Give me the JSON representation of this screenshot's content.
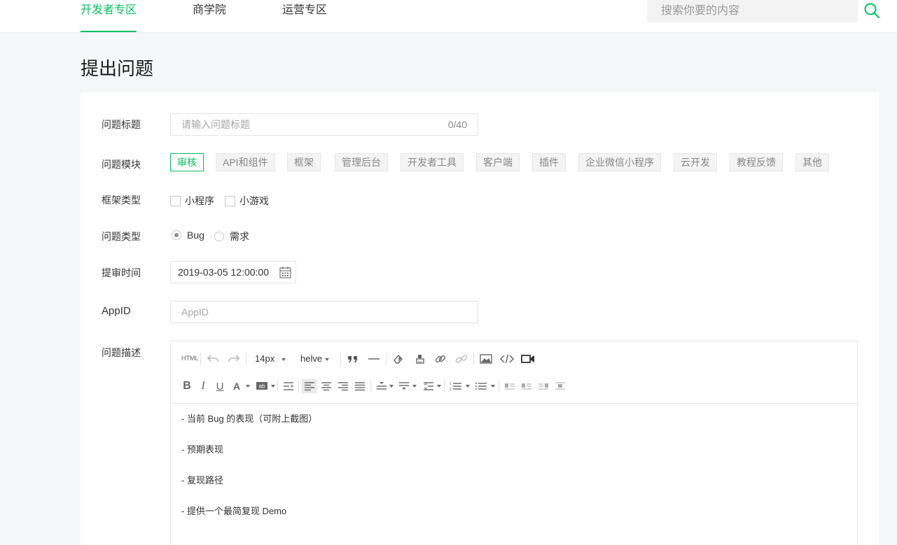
{
  "nav": {
    "tabs": [
      {
        "label": "开发者专区",
        "active": true
      },
      {
        "label": "商学院",
        "active": false
      },
      {
        "label": "运营专区",
        "active": false
      }
    ],
    "search_placeholder": "搜索你要的内容"
  },
  "page_title": "提出问题",
  "form": {
    "title_label": "问题标题",
    "title_placeholder": "请输入问题标题",
    "title_counter": "0/40",
    "module_label": "问题模块",
    "modules": [
      "审核",
      "API和组件",
      "框架",
      "管理后台",
      "开发者工具",
      "客户端",
      "插件",
      "企业微信小程序",
      "云开发",
      "教程反馈",
      "其他"
    ],
    "module_selected": "审核",
    "framework_label": "框架类型",
    "framework_options": [
      "小程序",
      "小游戏"
    ],
    "type_label": "问题类型",
    "type_options": [
      "Bug",
      "需求"
    ],
    "type_selected": "Bug",
    "time_label": "提审时间",
    "time_value": "2019-03-05 12:00:00",
    "appid_label": "AppID",
    "appid_placeholder": "AppID",
    "desc_label": "问题描述"
  },
  "editor": {
    "html_label": "HTML",
    "font_size": "14px",
    "font_family": "helve",
    "content": [
      "- 当前 Bug 的表现（可附上截图）",
      "- 预期表现",
      "- 复现路径",
      "- 提供一个最简复现 Demo"
    ]
  },
  "colors": {
    "accent": "#07c160",
    "page_bg": "#f6f7f8"
  }
}
